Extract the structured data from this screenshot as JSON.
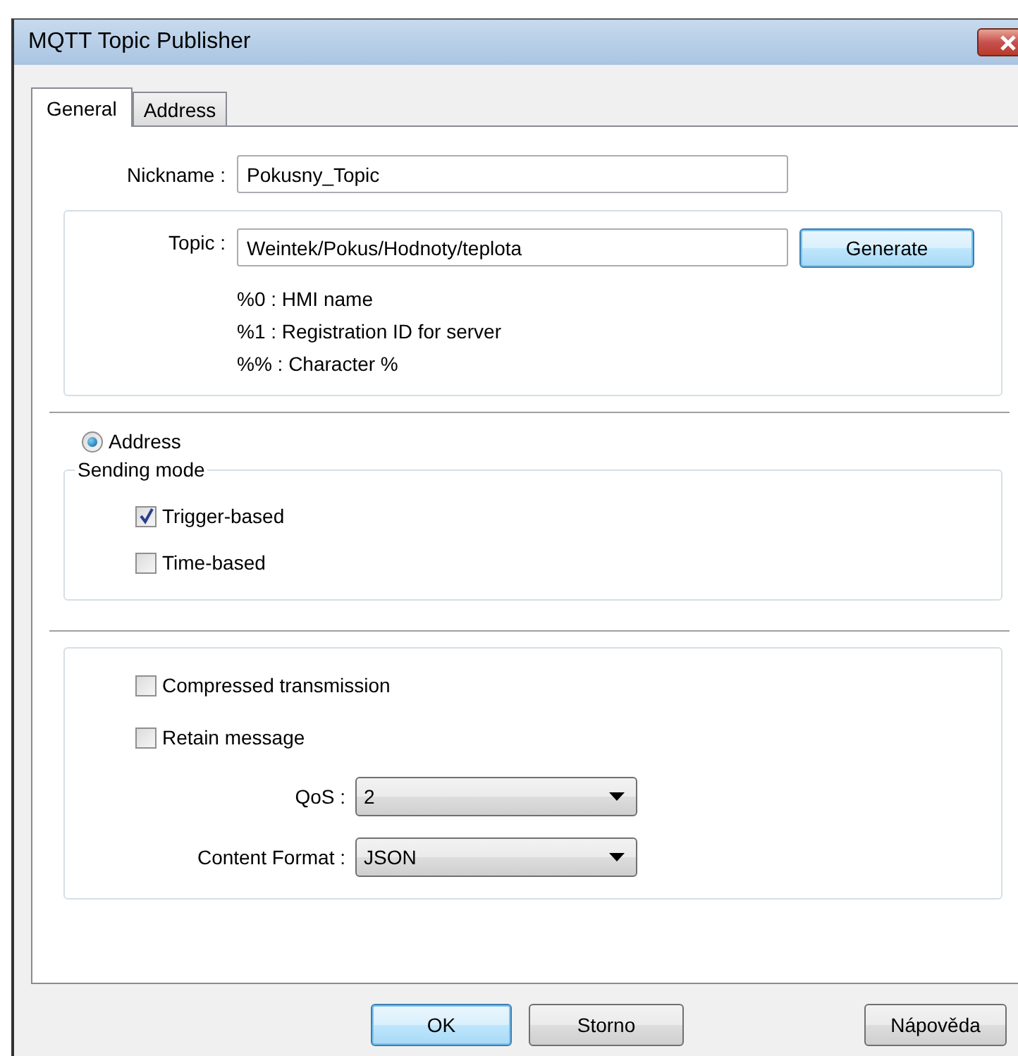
{
  "window": {
    "title": "MQTT Topic Publisher"
  },
  "tabs": [
    {
      "label": "General",
      "selected": true
    },
    {
      "label": "Address",
      "selected": false
    }
  ],
  "nickname": {
    "label": "Nickname :",
    "value": "Pokusny_Topic"
  },
  "topic": {
    "label": "Topic :",
    "value": "Weintek/Pokus/Hodnoty/teplota",
    "button": {
      "label": "Generate",
      "highlighted": true
    },
    "hints": [
      "%0 : HMI name",
      "%1 : Registration ID for server",
      "%% : Character %"
    ]
  },
  "source": {
    "label": "Address",
    "selected": true
  },
  "sending_mode": {
    "title": "Sending mode",
    "options": [
      {
        "label": "Trigger-based",
        "checked": true
      },
      {
        "label": "Time-based",
        "checked": false
      }
    ]
  },
  "options": [
    {
      "label": "Compressed transmission",
      "checked": false
    },
    {
      "label": "Retain message",
      "checked": false
    }
  ],
  "dropdowns": [
    {
      "label": "QoS :",
      "value": "2"
    },
    {
      "label": "Content Format :",
      "value": "JSON"
    }
  ],
  "buttons": [
    {
      "label": "OK",
      "default": true
    },
    {
      "label": "Storno",
      "default": false
    },
    {
      "label": "Nápověda",
      "default": false
    }
  ]
}
